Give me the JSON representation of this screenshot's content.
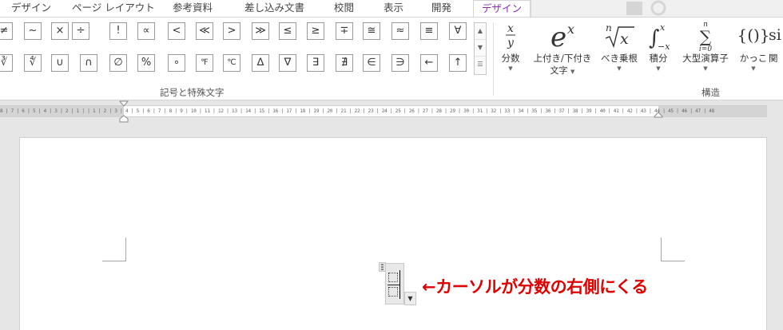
{
  "tabs": [
    {
      "label": "デザイン"
    },
    {
      "label": "ページ レイアウト"
    },
    {
      "label": "参考資料"
    },
    {
      "label": "差し込み文書"
    },
    {
      "label": "校閲"
    },
    {
      "label": "表示"
    },
    {
      "label": "開発"
    },
    {
      "label": "デザイン",
      "active": true
    }
  ],
  "symbols": {
    "row1": [
      "≠",
      "~",
      "×",
      "÷",
      "!",
      "∝",
      "<",
      "≪",
      ">",
      "≫",
      "≤",
      "≥",
      "∓",
      "≅",
      "≈",
      "≡",
      "∀"
    ],
    "row2": [
      "∛",
      "∜",
      "∪",
      "∩",
      "∅",
      "%",
      "∘",
      "℉",
      "℃",
      "∆",
      "∇",
      "∃",
      "∄",
      "∈",
      "∋",
      "←",
      "↑"
    ],
    "scroll": [
      "▲",
      "▼",
      "☰"
    ],
    "group_label": "記号と特殊文字"
  },
  "structures": {
    "group_label": "構造",
    "buttons": [
      {
        "label": "分数",
        "icon": "x/y"
      },
      {
        "label": "上付き/下付き",
        "label2": "文字",
        "icon": "eˣ"
      },
      {
        "label": "べき乗根",
        "icon": "ⁿ√x"
      },
      {
        "label": "積分",
        "icon": "∫"
      },
      {
        "label": "大型演算子",
        "icon": "∑"
      },
      {
        "label": "かっこ",
        "icon": "{()}"
      },
      {
        "label": "関",
        "icon": "si"
      }
    ]
  },
  "ruler": {
    "text": "8 | 7 | 6 | 5 | 4 | 3 | 2 | 1 |   | 1 | 2 | 3 | 4 | 5 | 6 | 7 | 8 | 9 | 10 | 11 | 12 | 13 | 14 | 15 | 16 | 17 | 18 | 19 | 20 | 21 | 22 | 23 | 24 | 25 | 26 | 27 | 28 | 29 | 30 | 31 | 32 | 33 | 34 | 35 | 36 | 37 | 38 | 39 | 40 | 41 | 42 | 43 | 44 | 45 | 46 | 47 | 48"
  },
  "annotation": {
    "text": "←カーソルが分数の右側にくる",
    "color": "#e00000"
  },
  "colors": {
    "active_tab": "#8e2fb5",
    "ribbon_bg": "#ffffff",
    "gutter": "#e6e6e6"
  }
}
